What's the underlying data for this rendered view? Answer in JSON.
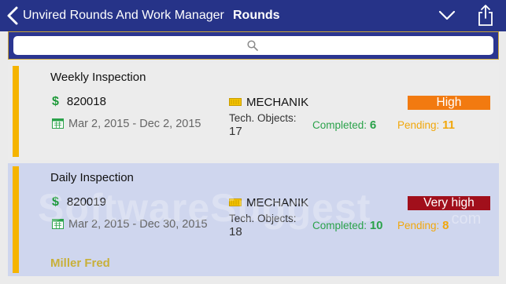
{
  "header": {
    "back_label": "Unvired Rounds And Work Manager",
    "page_title": "Rounds"
  },
  "search": {
    "placeholder": ""
  },
  "rounds": [
    {
      "title": "Weekly Inspection",
      "id": "820018",
      "date_range": "Mar 2, 2015 - Dec 2, 2015",
      "work_center": "MECHANIK",
      "tech_objects_label": "Tech. Objects:",
      "tech_objects": "17",
      "completed_label": "Completed:",
      "completed": "6",
      "pending_label": "Pending:",
      "pending": "11",
      "priority": "High",
      "priority_color": "#f27a10",
      "assignee": "",
      "selected": false
    },
    {
      "title": "Daily Inspection",
      "id": "820019",
      "date_range": "Mar 2, 2015 - Dec 30, 2015",
      "work_center": "MECHANIK",
      "tech_objects_label": "Tech. Objects:",
      "tech_objects": "18",
      "completed_label": "Completed:",
      "completed": "10",
      "pending_label": "Pending:",
      "pending": "8",
      "priority": "Very high",
      "priority_color": "#a10f1b",
      "assignee": "Miller Fred",
      "selected": true
    }
  ],
  "watermark": {
    "main": "SoftwareSuggest",
    "suffix": ".com"
  },
  "colors": {
    "nav_bar": "#263388",
    "accent_bar": "#f5b400",
    "completed": "#2aa24a",
    "pending": "#f1a70c",
    "selected_row": "#cfd6ee"
  },
  "icons": [
    "back-chevron-icon",
    "chevron-down-icon",
    "share-icon",
    "search-icon",
    "dollar-icon",
    "calendar-icon",
    "toolbox-icon"
  ]
}
